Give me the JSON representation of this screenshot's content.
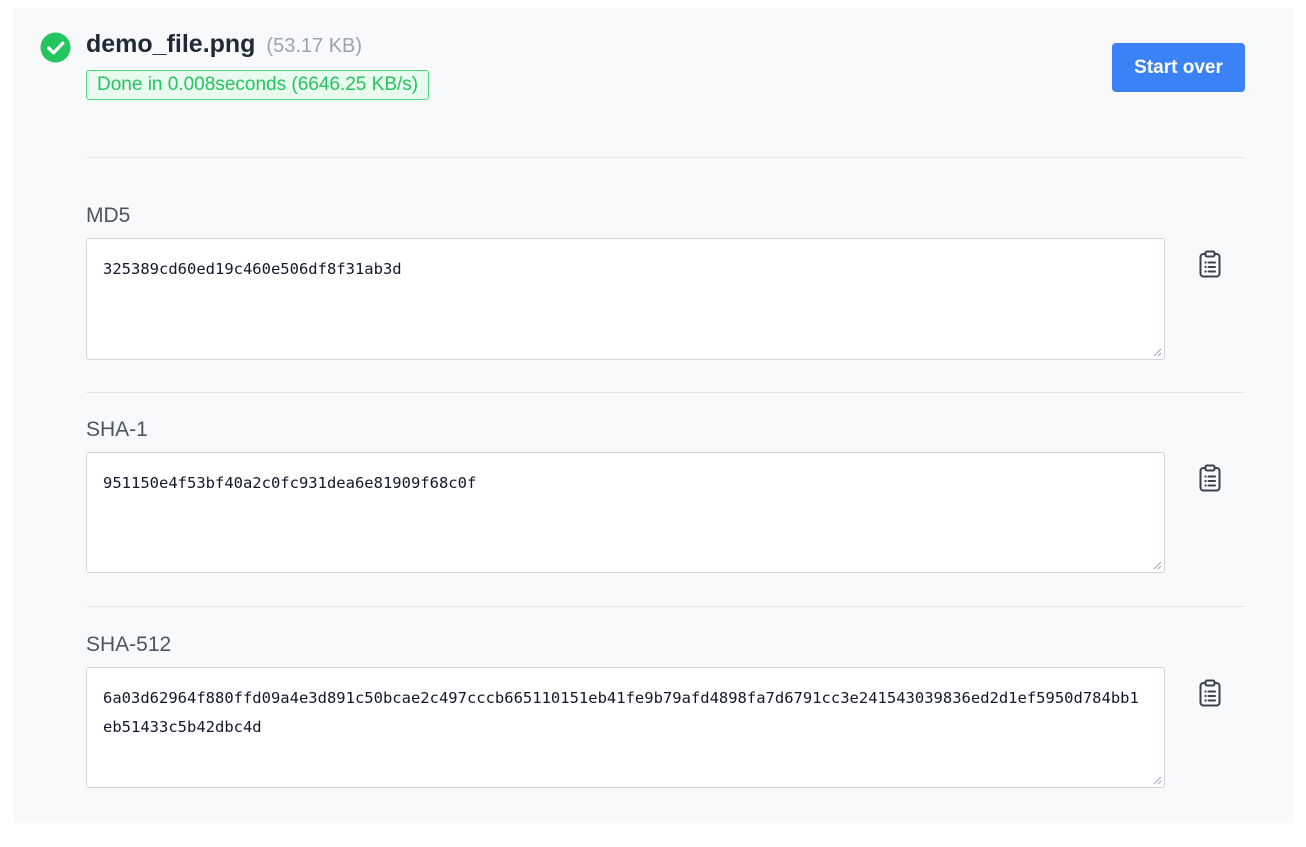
{
  "file": {
    "name": "demo_file.png",
    "size": "(53.17 KB)",
    "status": "Done in 0.008seconds (6646.25 KB/s)"
  },
  "actions": {
    "start_over_label": "Start over"
  },
  "hashes": [
    {
      "label": "MD5",
      "value": "325389cd60ed19c460e506df8f31ab3d"
    },
    {
      "label": "SHA-1",
      "value": "951150e4f53bf40a2c0fc931dea6e81909f68c0f"
    },
    {
      "label": "SHA-512",
      "value": "6a03d62964f880ffd09a4e3d891c50bcae2c497cccb665110151eb41fe9b79afd4898fa7d6791cc3e241543039836ed2d1ef5950d784bb1eb51433c5b42dbc4d"
    }
  ],
  "icons": {
    "status": "check-circle-icon",
    "copy": "clipboard-icon"
  },
  "colors": {
    "success": "#22c55e",
    "accent": "#3b82f6"
  }
}
